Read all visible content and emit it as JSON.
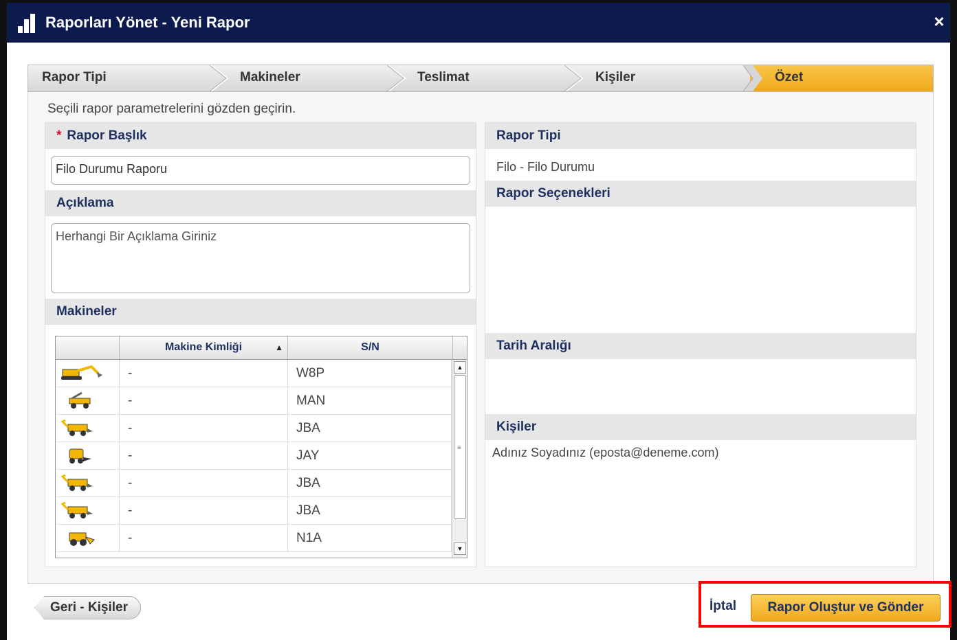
{
  "window": {
    "title": "Raporları Yönet - Yeni Rapor",
    "close": "×"
  },
  "wizard": {
    "steps": [
      {
        "label": "Rapor Tipi",
        "active": false
      },
      {
        "label": "Makineler",
        "active": false
      },
      {
        "label": "Teslimat",
        "active": false
      },
      {
        "label": "Kişiler",
        "active": false
      },
      {
        "label": "Özet",
        "active": true
      }
    ]
  },
  "intro": "Seçili rapor parametrelerini gözden geçirin.",
  "left": {
    "title_label": "Rapor Başlık",
    "required_mark": "*",
    "title_value": "Filo Durumu Raporu",
    "desc_label": "Açıklama",
    "desc_placeholder": "Herhangi Bir Açıklama Giriniz",
    "machines_label": "Makineler",
    "grid": {
      "columns": [
        "",
        "Makine Kimliği",
        "S/N"
      ],
      "sort_indicator": "▲",
      "rows": [
        {
          "icon": "excavator-icon",
          "id": "-",
          "sn": "W8P"
        },
        {
          "icon": "telehandler-icon",
          "id": "-",
          "sn": "MAN"
        },
        {
          "icon": "backhoe-loader-icon",
          "id": "-",
          "sn": "JBA"
        },
        {
          "icon": "skid-steer-icon",
          "id": "-",
          "sn": "JAY"
        },
        {
          "icon": "backhoe-loader-icon",
          "id": "-",
          "sn": "JBA"
        },
        {
          "icon": "backhoe-loader-icon",
          "id": "-",
          "sn": "JBA"
        },
        {
          "icon": "wheel-loader-icon",
          "id": "-",
          "sn": "N1A"
        }
      ]
    }
  },
  "right": {
    "report_type_label": "Rapor Tipi",
    "report_type_value": "Filo - Filo Durumu",
    "options_label": "Rapor Seçenekleri",
    "date_range_label": "Tarih Aralığı",
    "people_label": "Kişiler",
    "people_value": "Adınız Soyadınız (eposta@deneme.com)"
  },
  "footer": {
    "back_label": "Geri - Kişiler",
    "cancel_label": "İptal",
    "submit_label": "Rapor Oluştur ve Gönder"
  },
  "colors": {
    "title_bar": "#0d1a4e",
    "accent": "#f0a81c",
    "heading_text": "#1d2f5e",
    "highlight": "#ff0000"
  }
}
